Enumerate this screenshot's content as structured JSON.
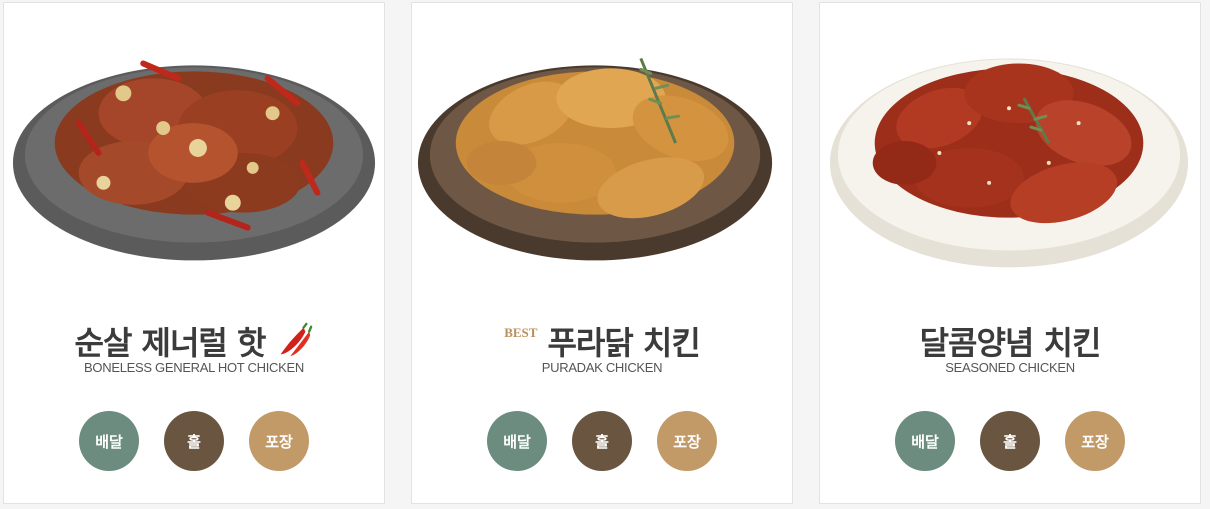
{
  "colors": {
    "delivery": "#6b8c7e",
    "hall": "#6a5541",
    "takeout": "#c29a68",
    "best": "#b98f5c"
  },
  "buttons": {
    "delivery": "배달",
    "hall": "홀",
    "takeout": "포장"
  },
  "menu": [
    {
      "title": "순살 제너럴 핫",
      "subtitle": "BONELESS GENERAL HOT CHICKEN",
      "icon": "chili-pepper-icon",
      "image": "boneless-general-hot-chicken-photo"
    },
    {
      "badge": "BEST",
      "title": "푸라닭 치킨",
      "subtitle": "PURADAK CHICKEN",
      "image": "puradak-chicken-photo"
    },
    {
      "title": "달콤양념 치킨",
      "subtitle": "SEASONED CHICKEN",
      "image": "seasoned-chicken-photo"
    }
  ]
}
